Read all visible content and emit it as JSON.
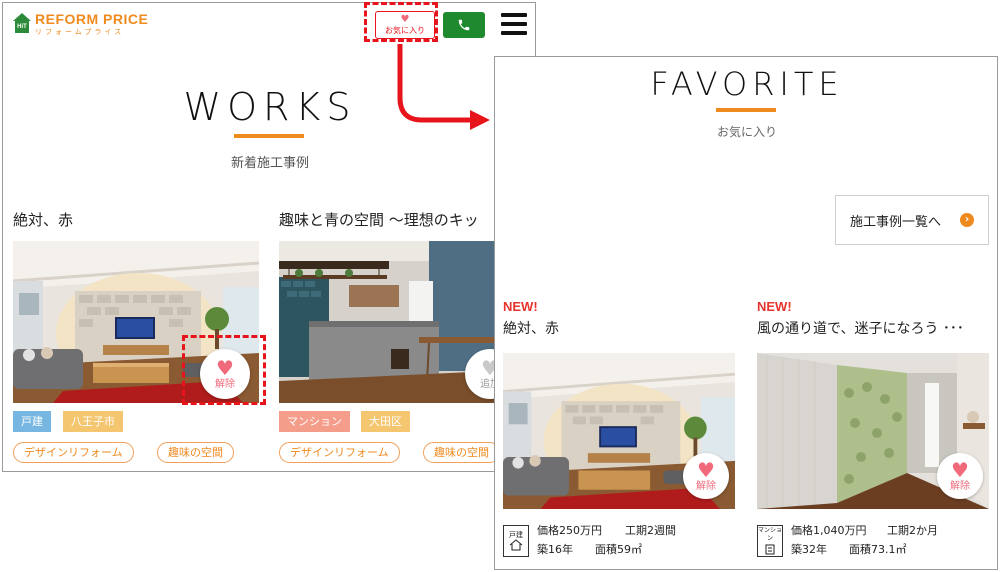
{
  "left": {
    "logo": {
      "mark": "HiT",
      "name": "REFORM PRICE",
      "kana": "リフォームプライス"
    },
    "header": {
      "fav_label": "お気に入り"
    },
    "section": {
      "title": "WORKS",
      "subtitle": "新着施工事例"
    },
    "cards": [
      {
        "title": "絶対、赤",
        "tags": [
          "戸建",
          "八王子市"
        ],
        "pills": [
          "デザインリフォーム",
          "趣味の空間"
        ],
        "remove_label": "解除"
      },
      {
        "title": "趣味と青の空間 〜理想のキッ",
        "tags": [
          "マンション",
          "大田区"
        ],
        "pills": [
          "デザインリフォーム",
          "趣味の空間"
        ],
        "remove_label": "追加"
      }
    ]
  },
  "right": {
    "section": {
      "title": "FAVORITE",
      "subtitle": "お気に入り"
    },
    "list_button": "施工事例一覧へ",
    "cards": [
      {
        "badge": "NEW!",
        "title": "絶対、赤",
        "remove_label": "解除",
        "type": "戸建",
        "price": "価格250万円",
        "period": "工期2週間",
        "age": "築16年",
        "area": "面積59㎡"
      },
      {
        "badge": "NEW!",
        "title": "風の通り道で、迷子になろう ･･･",
        "remove_label": "解除",
        "type": "マンション",
        "price": "価格1,040万円",
        "period": "工期2か月",
        "age": "築32年",
        "area": "面積73.1㎡"
      }
    ]
  },
  "colors": {
    "accent": "#ef8a1f",
    "highlight": "#e8141b",
    "heart": "#f06a7c",
    "tel": "#1f8a2d"
  },
  "icons": [
    "heart-icon",
    "phone-icon",
    "menu-icon",
    "chevron-right-icon",
    "house-icon",
    "building-icon"
  ]
}
